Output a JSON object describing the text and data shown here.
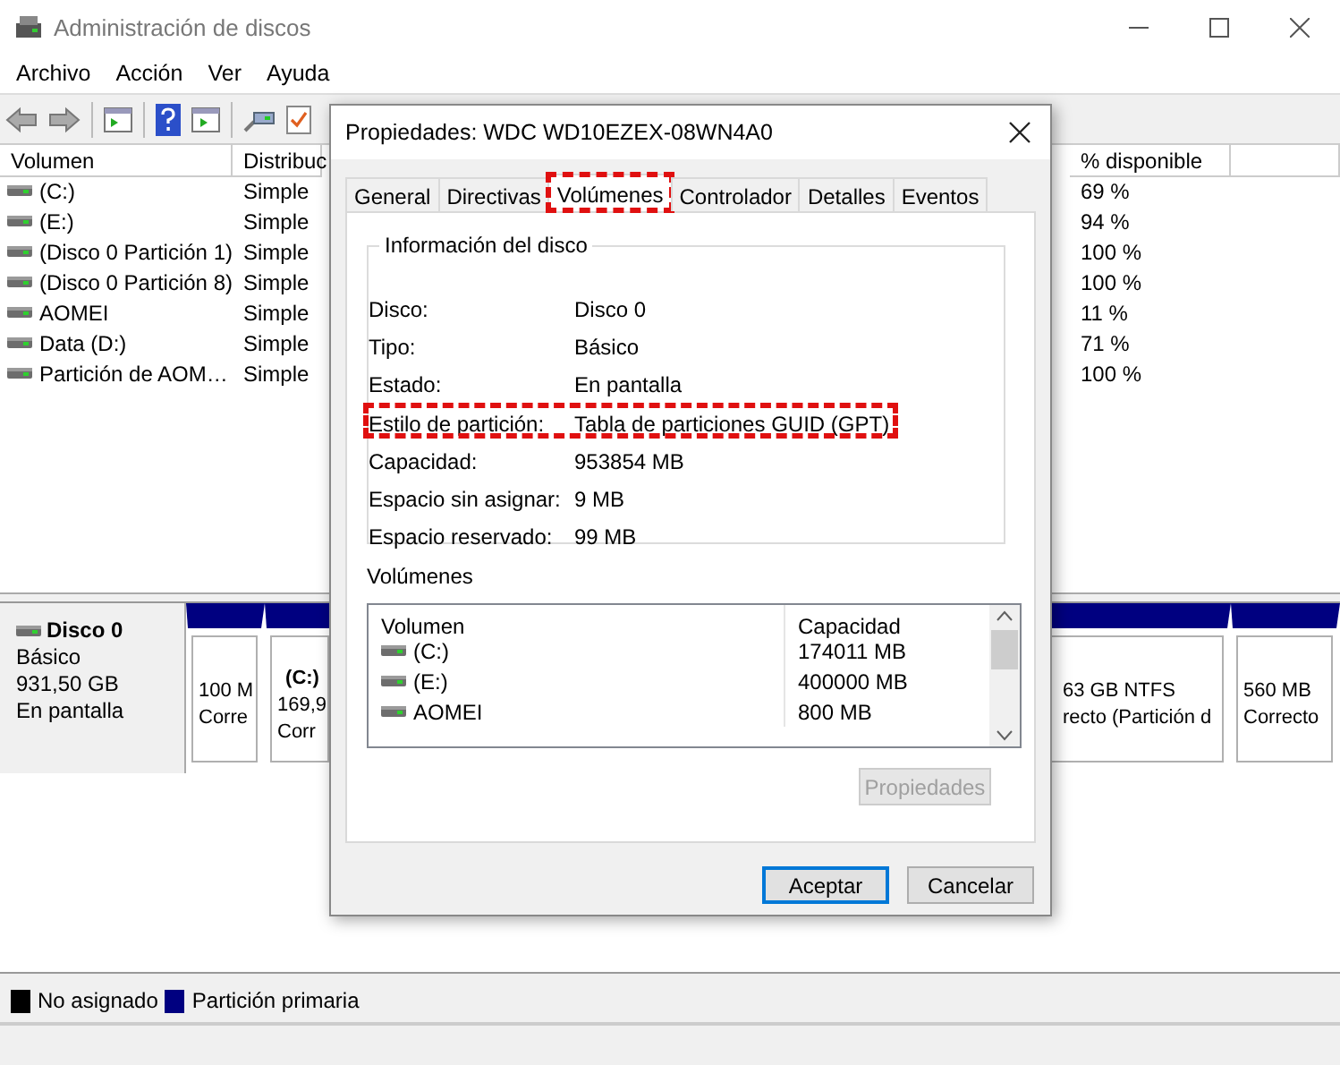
{
  "window": {
    "title": "Administración de discos"
  },
  "menu": [
    "Archivo",
    "Acción",
    "Ver",
    "Ayuda"
  ],
  "volume_table": {
    "columns": [
      "Volumen",
      "Distribuc",
      "% disponible"
    ],
    "rows": [
      {
        "volume": "(C:)",
        "layout": "Simple",
        "free": "69 %"
      },
      {
        "volume": "(E:)",
        "layout": "Simple",
        "free": "94 %"
      },
      {
        "volume": "(Disco 0 Partición 1)",
        "layout": "Simple",
        "free": "100 %"
      },
      {
        "volume": "(Disco 0 Partición 8)",
        "layout": "Simple",
        "free": "100 %"
      },
      {
        "volume": "AOMEI",
        "layout": "Simple",
        "free": "11 %"
      },
      {
        "volume": "Data (D:)",
        "layout": "Simple",
        "free": "71 %"
      },
      {
        "volume": "Partición de AOM…",
        "layout": "Simple",
        "free": "100 %"
      }
    ]
  },
  "disk": {
    "name": "Disco 0",
    "type": "Básico",
    "size": "931,50 GB",
    "status": "En pantalla",
    "partitions": [
      {
        "lines": [
          "100 M",
          "Corre"
        ]
      },
      {
        "label": "(C:)",
        "lines": [
          "169,9",
          "Corr"
        ]
      },
      {
        "lines": [
          "63 GB NTFS",
          "recto (Partición d"
        ]
      },
      {
        "lines": [
          "560 MB",
          "Correcto"
        ]
      }
    ]
  },
  "legend": [
    {
      "label": "No asignado",
      "color": "#000000"
    },
    {
      "label": "Partición primaria",
      "color": "#000080"
    }
  ],
  "dialog": {
    "title": "Propiedades: WDC WD10EZEX-08WN4A0",
    "tabs": [
      {
        "label": "General",
        "selected": false,
        "highlighted": false
      },
      {
        "label": "Directivas",
        "selected": false,
        "highlighted": false
      },
      {
        "label": "Volúmenes",
        "selected": true,
        "highlighted": true
      },
      {
        "label": "Controlador",
        "selected": false,
        "highlighted": false
      },
      {
        "label": "Detalles",
        "selected": false,
        "highlighted": false
      },
      {
        "label": "Eventos",
        "selected": false,
        "highlighted": false
      }
    ],
    "group_title": "Información del disco",
    "fields": [
      {
        "label": "Disco:",
        "value": "Disco 0",
        "highlighted": false
      },
      {
        "label": "Tipo:",
        "value": "Básico",
        "highlighted": false
      },
      {
        "label": "Estado:",
        "value": "En pantalla",
        "highlighted": false
      },
      {
        "label": "Estilo de partición:",
        "value": "Tabla de particiones GUID (GPT)",
        "highlighted": true
      },
      {
        "label": "Capacidad:",
        "value": "953854 MB",
        "highlighted": false
      },
      {
        "label": "Espacio sin asignar:",
        "value": "9 MB",
        "highlighted": false
      },
      {
        "label": "Espacio reservado:",
        "value": "99 MB",
        "highlighted": false
      }
    ],
    "volumes_label": "Volúmenes",
    "volumes_list": {
      "columns": [
        "Volumen",
        "Capacidad"
      ],
      "rows": [
        {
          "name": "(C:)",
          "capacity": "174011 MB"
        },
        {
          "name": "(E:)",
          "capacity": "400000 MB"
        },
        {
          "name": "AOMEI",
          "capacity": "800 MB"
        }
      ]
    },
    "properties_button": {
      "label": "Propiedades",
      "disabled": true
    },
    "buttons": [
      {
        "label": "Aceptar",
        "default": true
      },
      {
        "label": "Cancelar",
        "default": false
      }
    ]
  }
}
